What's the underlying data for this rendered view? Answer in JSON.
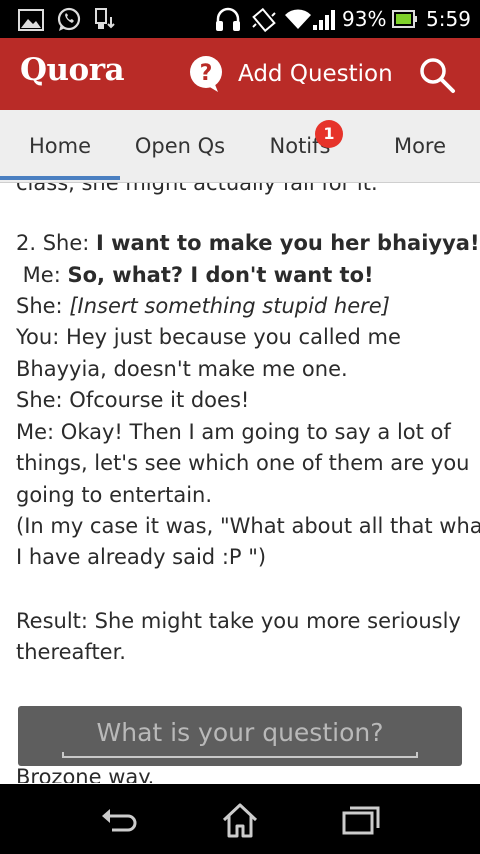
{
  "status_bar": {
    "battery": "93%",
    "time": "5:59",
    "icons": [
      "gallery-icon",
      "whatsapp-icon",
      "usb-download-icon",
      "headset-icon",
      "vibrate-icon",
      "wifi-icon",
      "signal-icon",
      "battery-icon"
    ]
  },
  "header": {
    "logo": "Quora",
    "add_question_label": "Add Question",
    "brand_color": "#b92b27"
  },
  "tabs": [
    {
      "label": "Home",
      "active": true
    },
    {
      "label": "Open Qs",
      "active": false
    },
    {
      "label": "Notifs",
      "active": false,
      "badge": "1"
    },
    {
      "label": "More",
      "active": false
    }
  ],
  "answer": {
    "cut_top": "class, she might actually fall for it.",
    "p2_prefix": "2. She: ",
    "p2_bold": "I want to make you her bhaiyya!",
    "me_prefix": " Me: ",
    "me_bold": "So, what? I don't want to!",
    "she_prefix": "She: ",
    "she_italic": "[Insert something stupid here]",
    "lines": [
      "You: Hey just because you called me",
      "Bhayyia, doesn't make me one.",
      "She: Ofcourse it does!",
      "Me: Okay! Then I am going to say a lot of",
      "things, let's see which one of them are you",
      "going to entertain.",
      "(In my case it was, \"What about all that what",
      "I have already said :P \")",
      "Result: She might take you more seriously",
      "thereafter."
    ],
    "cut_bottom": "Brozone way."
  },
  "ask_bar": {
    "placeholder": "What is your question?"
  },
  "nav": [
    "back-icon",
    "home-icon",
    "recent-apps-icon"
  ]
}
